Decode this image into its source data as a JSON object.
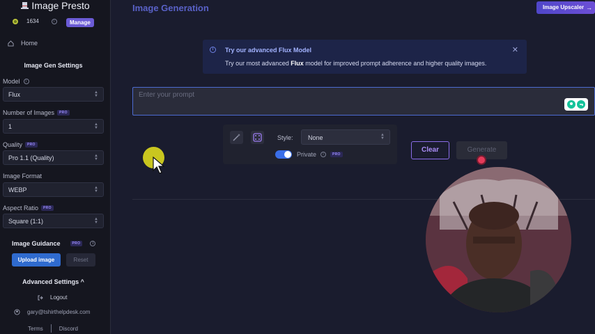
{
  "app": {
    "name": "Image Presto"
  },
  "account": {
    "credits": "1634",
    "manage_label": "Manage"
  },
  "nav": {
    "home_label": "Home"
  },
  "sidebar": {
    "section_title": "Image Gen Settings",
    "model": {
      "label": "Model",
      "value": "Flux"
    },
    "num_images": {
      "label": "Number of Images",
      "badge": "PRO",
      "value": "1"
    },
    "quality": {
      "label": "Quality",
      "badge": "PRO",
      "value": "Pro 1.1 (Quality)"
    },
    "format": {
      "label": "Image Format",
      "value": "WEBP"
    },
    "aspect": {
      "label": "Aspect Ratio",
      "badge": "PRO",
      "value": "Square (1:1)"
    },
    "guidance": {
      "label": "Image Guidance",
      "badge": "PRO",
      "upload_label": "Upload image",
      "reset_label": "Reset"
    },
    "advanced_label": "Advanced Settings ^",
    "logout_label": "Logout",
    "email": "gary@tshirthelpdesk.com",
    "footer": {
      "terms": "Terms",
      "discord": "Discord"
    }
  },
  "main": {
    "title": "Image Generation",
    "upscaler_label": "Image Upscaler",
    "alert": {
      "title": "Try our advanced Flux Model",
      "text_before": "Try our most advanced ",
      "text_bold": "Flux",
      "text_after": " model for improved prompt adherence and higher quality images."
    },
    "prompt": {
      "placeholder": "Enter your prompt",
      "value": ""
    },
    "style": {
      "label": "Style:",
      "value": "None"
    },
    "private": {
      "label": "Private",
      "badge": "PRO",
      "enabled": true
    },
    "clear_label": "Clear",
    "generate_label": "Generate"
  },
  "colors": {
    "accent": "#5961c7",
    "primary_button": "#2f6bcf",
    "manage_button": "#6b5bd6",
    "clear_border": "#8a6de8",
    "alert_bg": "#1d2448"
  },
  "icons": [
    "hat-logo-icon",
    "coin-icon",
    "info-icon",
    "home-icon",
    "wand-icon",
    "dice-icon",
    "close-icon",
    "logout-icon",
    "user-icon",
    "arrow-right-icon",
    "grammarly-icon",
    "chevron-updown-icon"
  ]
}
